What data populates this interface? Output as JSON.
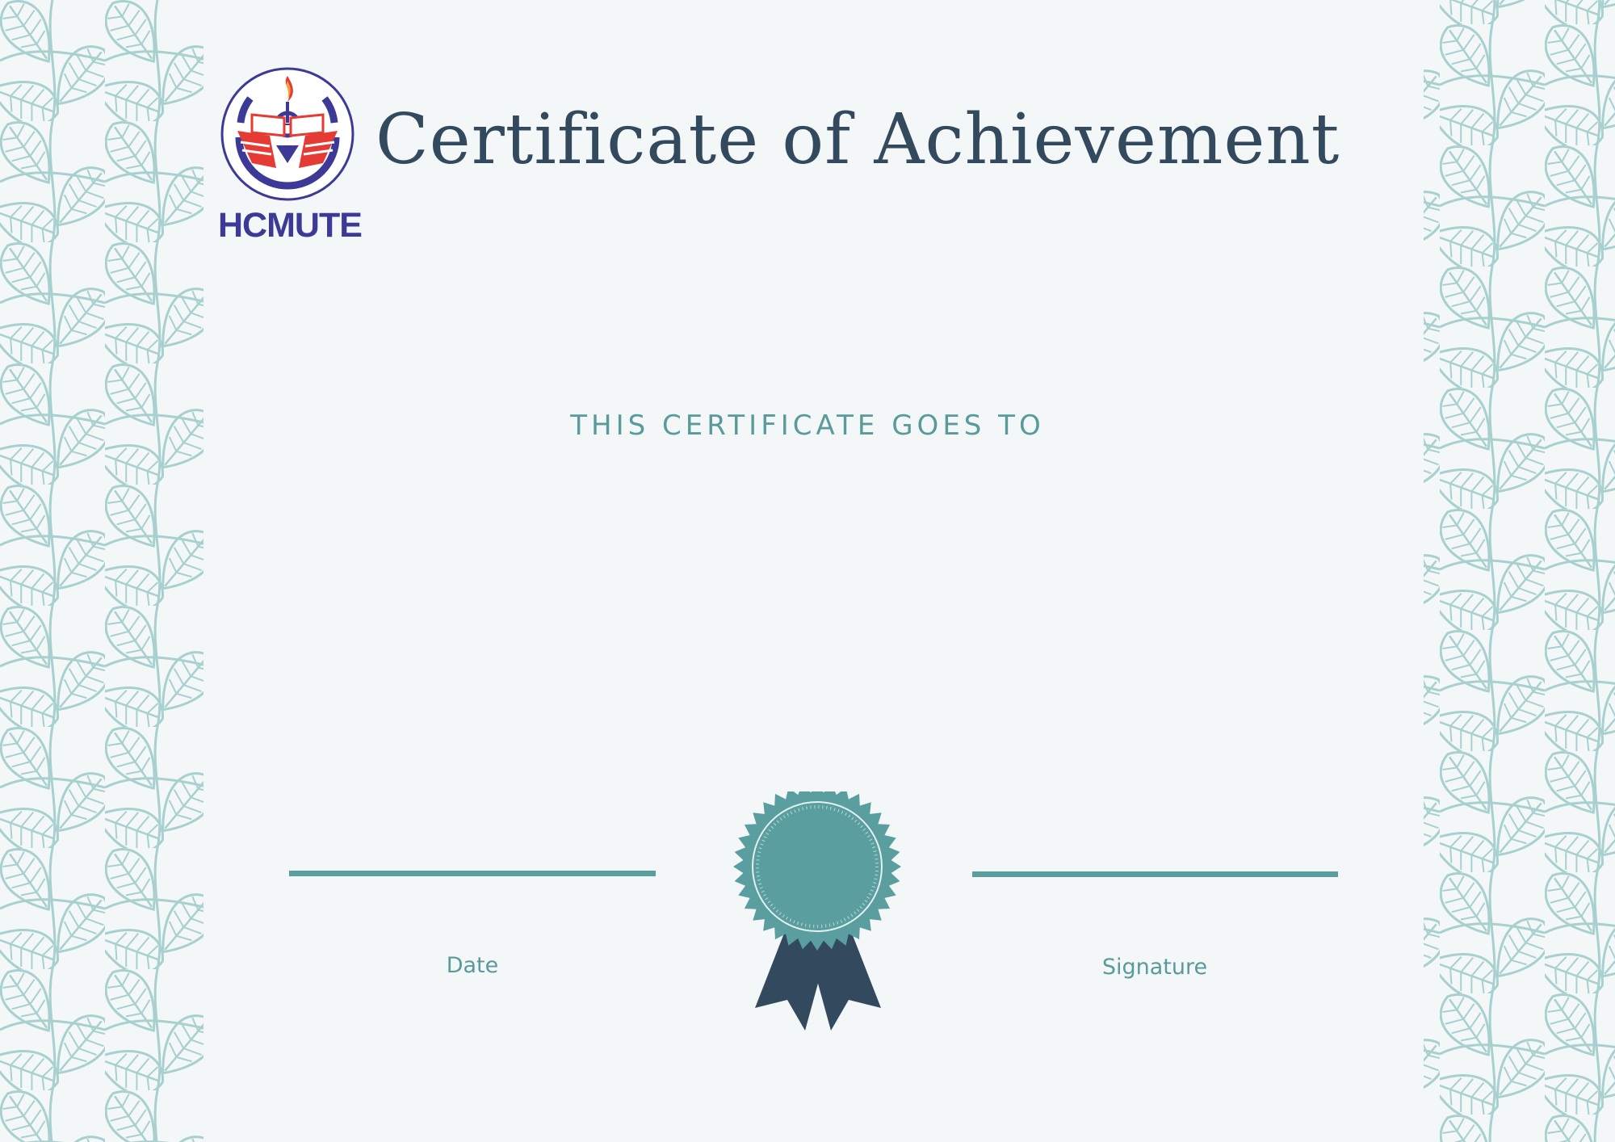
{
  "certificate": {
    "title": "Certificate of Achievement",
    "subtitle": "THIS CERTIFICATE GOES TO",
    "date_label": "Date",
    "signature_label": "Signature"
  },
  "logo": {
    "text": "HCMUTE",
    "icon": "hcmute-emblem-icon"
  },
  "decoration": {
    "border_pattern": "leaf-pattern",
    "seal_icon": "award-ribbon-seal-icon"
  },
  "colors": {
    "background": "#f3f7f8",
    "pattern": "#a7d0cf",
    "title": "#33495e",
    "accent": "#5a9ea0",
    "ribbon": "#33495e",
    "logo_blue": "#3c3a96",
    "logo_red": "#e63a34"
  }
}
